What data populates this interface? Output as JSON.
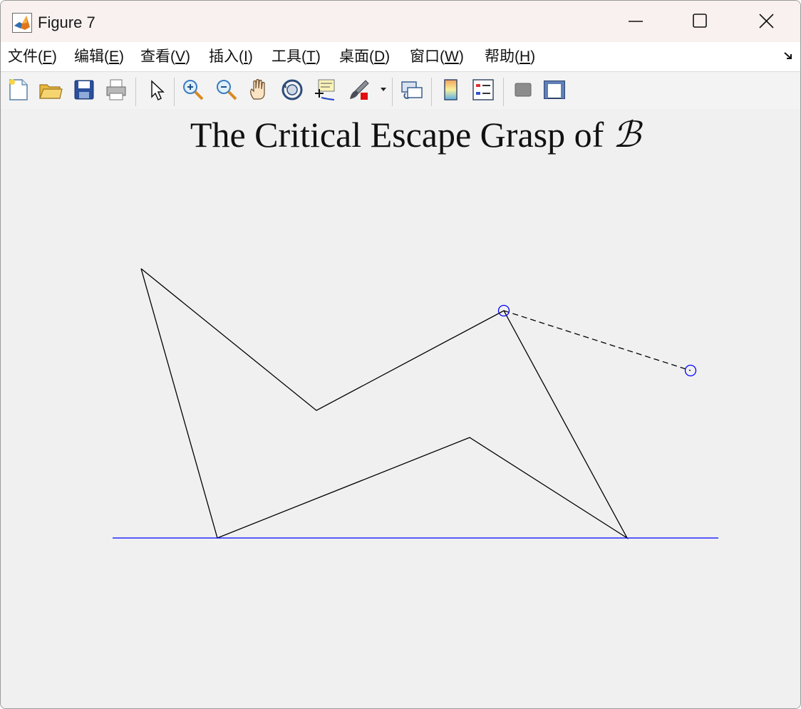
{
  "window": {
    "title": "Figure 7",
    "controls": [
      "minimize",
      "maximize",
      "close"
    ]
  },
  "menu": {
    "items": [
      {
        "text": "文件(",
        "key": "F",
        "end": ")"
      },
      {
        "text": "编辑(",
        "key": "E",
        "end": ")"
      },
      {
        "text": "查看(",
        "key": "V",
        "end": ")"
      },
      {
        "text": "插入(",
        "key": "I",
        "end": ")"
      },
      {
        "text": "工具(",
        "key": "T",
        "end": ")"
      },
      {
        "text": "桌面(",
        "key": "D",
        "end": ")"
      },
      {
        "text": "窗口(",
        "key": "W",
        "end": ")"
      },
      {
        "text": "帮助(",
        "key": "H",
        "end": ")"
      }
    ]
  },
  "toolbar": {
    "icons": [
      "new-figure-icon",
      "open-file-icon",
      "save-icon",
      "print-icon",
      "select-arrow-icon",
      "zoom-in-icon",
      "zoom-out-icon",
      "pan-hand-icon",
      "rotate-3d-icon",
      "data-cursor-icon",
      "brush-icon",
      "link-plot-icon",
      "colorbar-icon",
      "legend-icon",
      "hide-plot-tools-icon",
      "show-plot-tools-icon"
    ]
  },
  "plot": {
    "title_text": "The Critical Escape Grasp of ",
    "title_symbol": "ℬ"
  },
  "chart_data": {
    "type": "line",
    "title": "The Critical Escape Grasp of ℬ",
    "axes_visible": false,
    "series": [
      {
        "style": "solid",
        "color": "#000000",
        "x": [
          197,
          443,
          706,
          879,
          658,
          304,
          197
        ],
        "y": [
          376,
          575,
          435,
          754,
          613,
          754,
          376
        ]
      },
      {
        "style": "dashed",
        "color": "#000000",
        "x": [
          706,
          968
        ],
        "y": [
          435,
          519
        ]
      },
      {
        "style": "solid",
        "color": "#0000ff",
        "x": [
          157,
          1007
        ],
        "y": [
          754,
          754
        ]
      }
    ],
    "markers": [
      {
        "shape": "circle",
        "color": "#0000ff",
        "x": 706,
        "y": 435
      },
      {
        "shape": "circle",
        "color": "#0000ff",
        "x": 968,
        "y": 519
      }
    ],
    "y_direction": "down"
  },
  "colors": {
    "ground_line": "#0000ff",
    "markers": "#0000ff",
    "polygon": "#000000"
  }
}
